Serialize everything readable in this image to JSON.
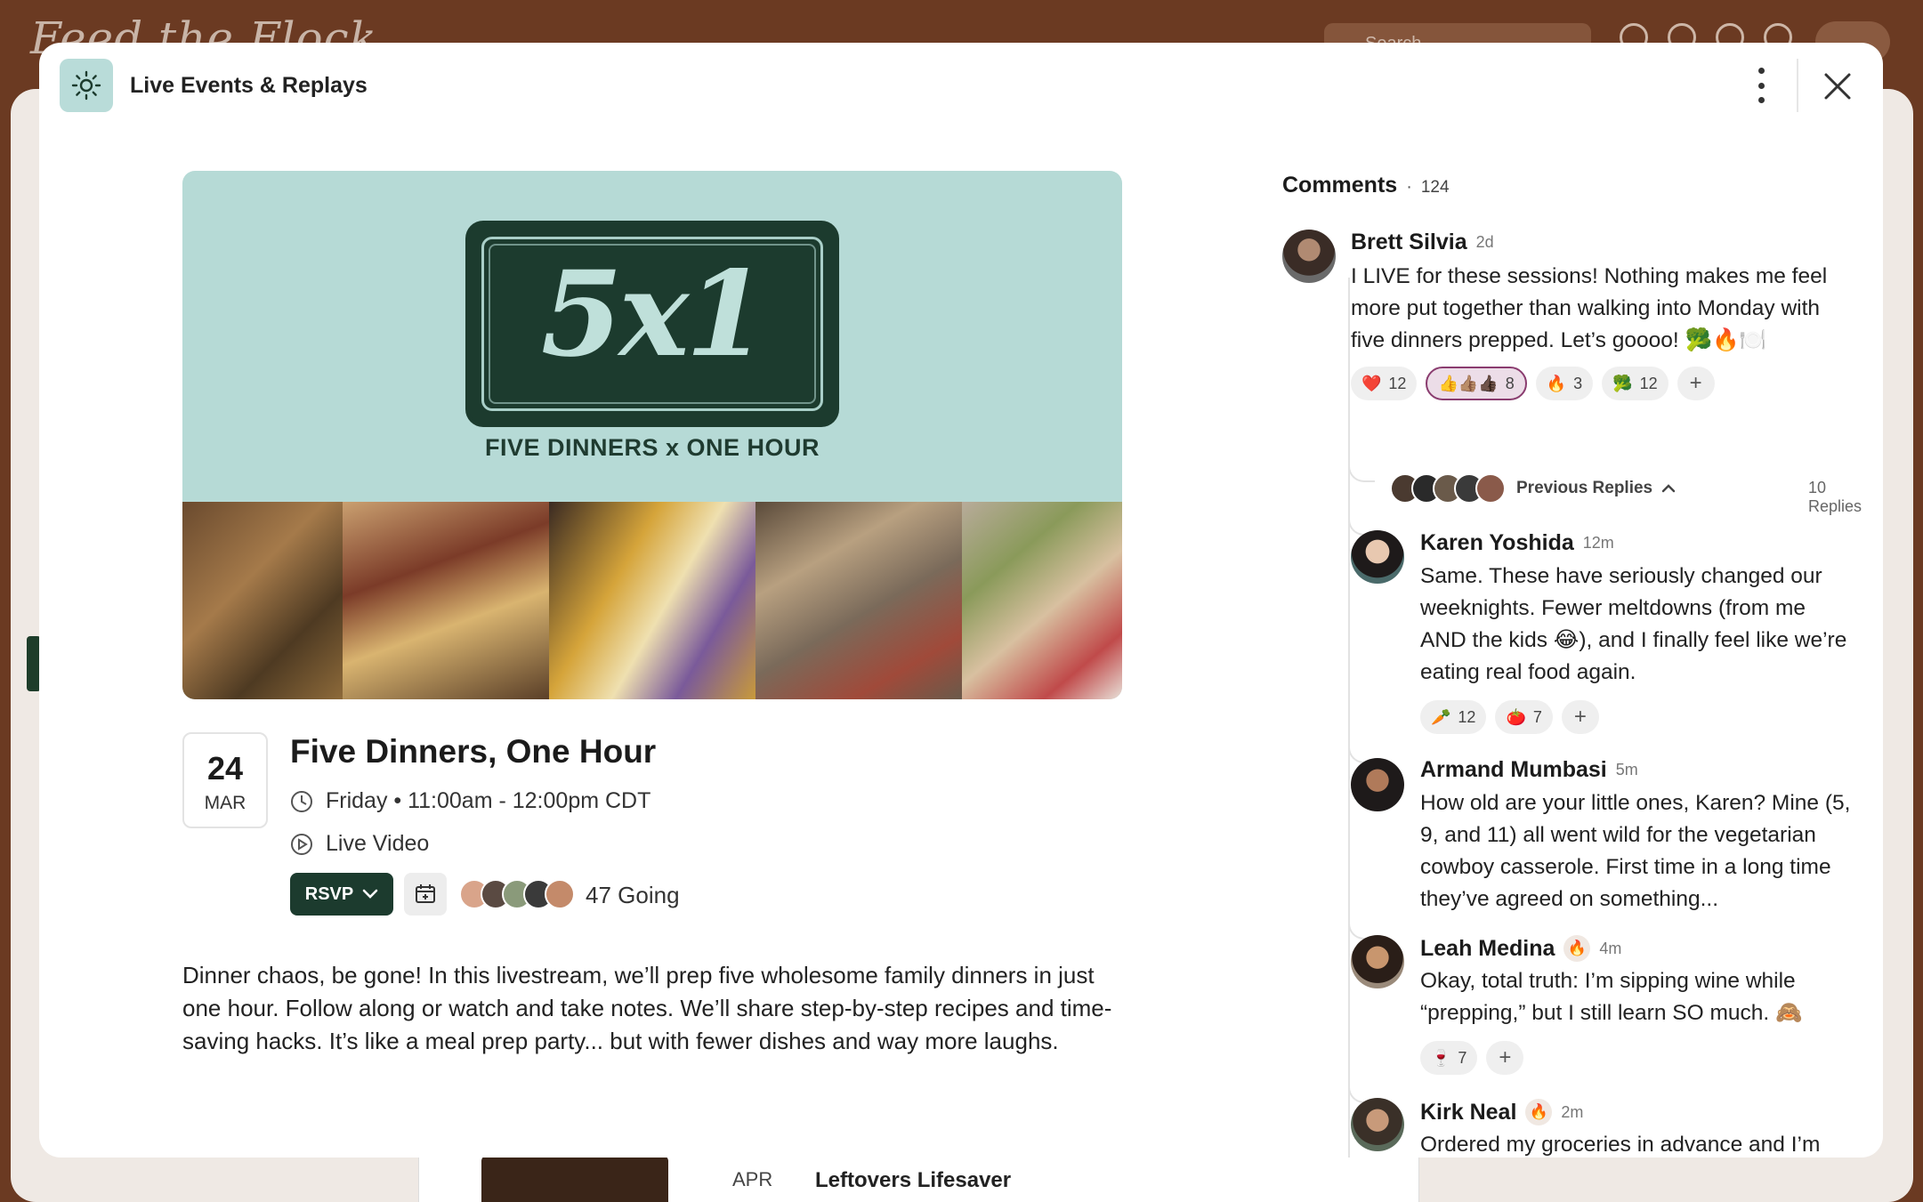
{
  "background": {
    "logo_text": "Feed the Flock",
    "search_placeholder": "Search",
    "card_date": "APR",
    "card_title": "Leftovers Lifesaver"
  },
  "modal": {
    "title": "Live Events & Replays"
  },
  "event": {
    "hero_board_text": "5x1",
    "hero_subtitle": "FIVE DINNERS x ONE HOUR",
    "date_day": "24",
    "date_month": "MAR",
    "title": "Five Dinners, One Hour",
    "schedule": "Friday • 11:00am - 12:00pm CDT",
    "format": "Live Video",
    "rsvp_label": "RSVP",
    "going": "47 Going",
    "description": "Dinner chaos, be gone! In this livestream, we’ll prep five wholesome family dinners in just one hour. Follow along or watch and take notes. We’ll share step-by-step recipes and time-saving hacks. It’s like a meal prep party... but with fewer dishes and way more laughs."
  },
  "comments": {
    "label": "Comments",
    "count": "124",
    "previous_replies": "Previous Replies",
    "replies_count": "10 Replies",
    "items": [
      {
        "name": "Brett Silvia",
        "ago": "2d",
        "text": "I LIVE for these sessions! Nothing makes me feel more put together than walking into Monday with five dinners prepped. Let’s goooo! 🥦🔥🍽️",
        "reactions": [
          {
            "emoji": "❤️",
            "count": "12"
          },
          {
            "emoji": "👍👍🏽👍🏿",
            "count": "8"
          },
          {
            "emoji": "🔥",
            "count": "3"
          },
          {
            "emoji": "🥦",
            "count": "12"
          }
        ]
      },
      {
        "name": "Karen Yoshida",
        "ago": "12m",
        "text": "Same. These have seriously changed our weeknights. Fewer meltdowns (from me AND the kids 😂), and I finally feel like we’re eating real food again.",
        "reactions": [
          {
            "emoji": "🥕",
            "count": "12"
          },
          {
            "emoji": "🍅",
            "count": "7"
          }
        ]
      },
      {
        "name": "Armand Mumbasi",
        "ago": "5m",
        "text": "How old are your little ones, Karen? Mine (5, 9, and 11) all went wild for the vegetarian cowboy casserole. First time in a long time they’ve agreed on something...",
        "reactions": []
      },
      {
        "name": "Leah Medina",
        "badge": "🔥",
        "ago": "4m",
        "text": "Okay, total truth: I’m sipping wine while “prepping,” but I still learn SO much. 🙈",
        "reactions": [
          {
            "emoji": "🍷",
            "count": "7"
          }
        ]
      },
      {
        "name": "Kirk Neal",
        "badge": "🔥",
        "ago": "2m",
        "text": "Ordered my groceries in advance and I’m READY. Who am I??",
        "reactions": []
      }
    ]
  }
}
